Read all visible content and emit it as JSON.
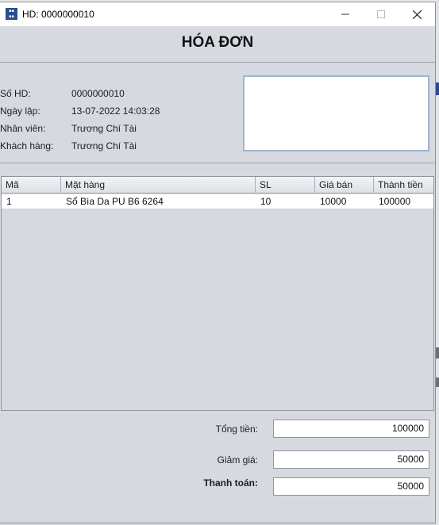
{
  "window": {
    "title": "HD: 0000000010",
    "icon": "app-logo-icon",
    "controls": {
      "minimize_icon": "minimize-icon",
      "maximize_icon": "maximize-icon",
      "close_icon": "close-icon"
    }
  },
  "heading": "HÓA ĐƠN",
  "info": {
    "invoice_no_label": "Số HD:",
    "invoice_no": "0000000010",
    "date_label": "Ngày lập:",
    "date": "13-07-2022 14:03:28",
    "employee_label": "Nhân viên:",
    "employee": "Trương Chí Tài",
    "customer_label": "Khách hàng:",
    "customer": "Trương Chí Tài"
  },
  "table": {
    "columns": [
      "Mã",
      "Mặt hàng",
      "SL",
      "Giá bán",
      "Thành tiền"
    ],
    "rows": [
      [
        "1",
        "Sổ Bìa Da PU B6 6264",
        "10",
        "10000",
        "100000"
      ]
    ]
  },
  "summary": {
    "total_label": "Tổng tiền:",
    "total": "100000",
    "discount_label": "Giảm giá:",
    "discount": "50000",
    "payment_label": "Thanh toán:",
    "payment": "50000"
  },
  "colors": {
    "window_bg": "#d6d9e0",
    "image_border": "#9fb3cc"
  }
}
